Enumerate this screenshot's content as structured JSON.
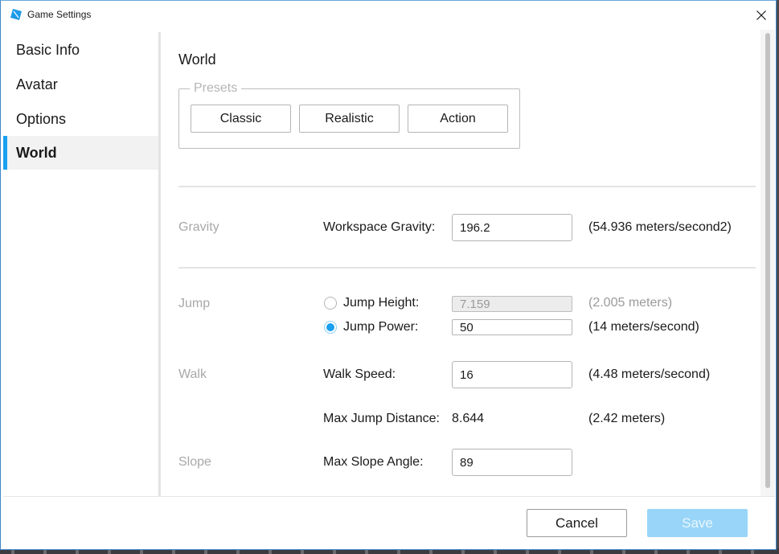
{
  "window": {
    "title": "Game Settings",
    "app_icon": "roblox-studio-icon",
    "close_icon": "close-icon"
  },
  "sidebar": {
    "items": [
      {
        "label": "Basic Info",
        "active": false
      },
      {
        "label": "Avatar",
        "active": false
      },
      {
        "label": "Options",
        "active": false
      },
      {
        "label": "World",
        "active": true
      }
    ]
  },
  "main": {
    "title": "World",
    "presets": {
      "legend": "Presets",
      "buttons": [
        "Classic",
        "Realistic",
        "Action"
      ]
    },
    "gravity": {
      "section": "Gravity",
      "label": "Workspace Gravity:",
      "value": "196.2",
      "unit": "(54.936 meters/second2)"
    },
    "jump": {
      "section": "Jump",
      "height_label": "Jump Height:",
      "height_value": "7.159",
      "height_unit": "(2.005 meters)",
      "height_selected": false,
      "power_label": "Jump Power:",
      "power_value": "50",
      "power_unit": "(14 meters/second)",
      "power_selected": true
    },
    "walk": {
      "section": "Walk",
      "label": "Walk Speed:",
      "value": "16",
      "unit": "(4.48 meters/second)"
    },
    "max_jump": {
      "label": "Max Jump Distance:",
      "value": "8.644",
      "unit": "(2.42 meters)"
    },
    "slope": {
      "section": "Slope",
      "label": "Max Slope Angle:",
      "value": "89"
    }
  },
  "footer": {
    "cancel_label": "Cancel",
    "save_label": "Save",
    "save_enabled": false
  },
  "colors": {
    "accent": "#1aa0f0",
    "save_disabled_bg": "#99d5f8",
    "muted_text": "#a8a8a8"
  }
}
